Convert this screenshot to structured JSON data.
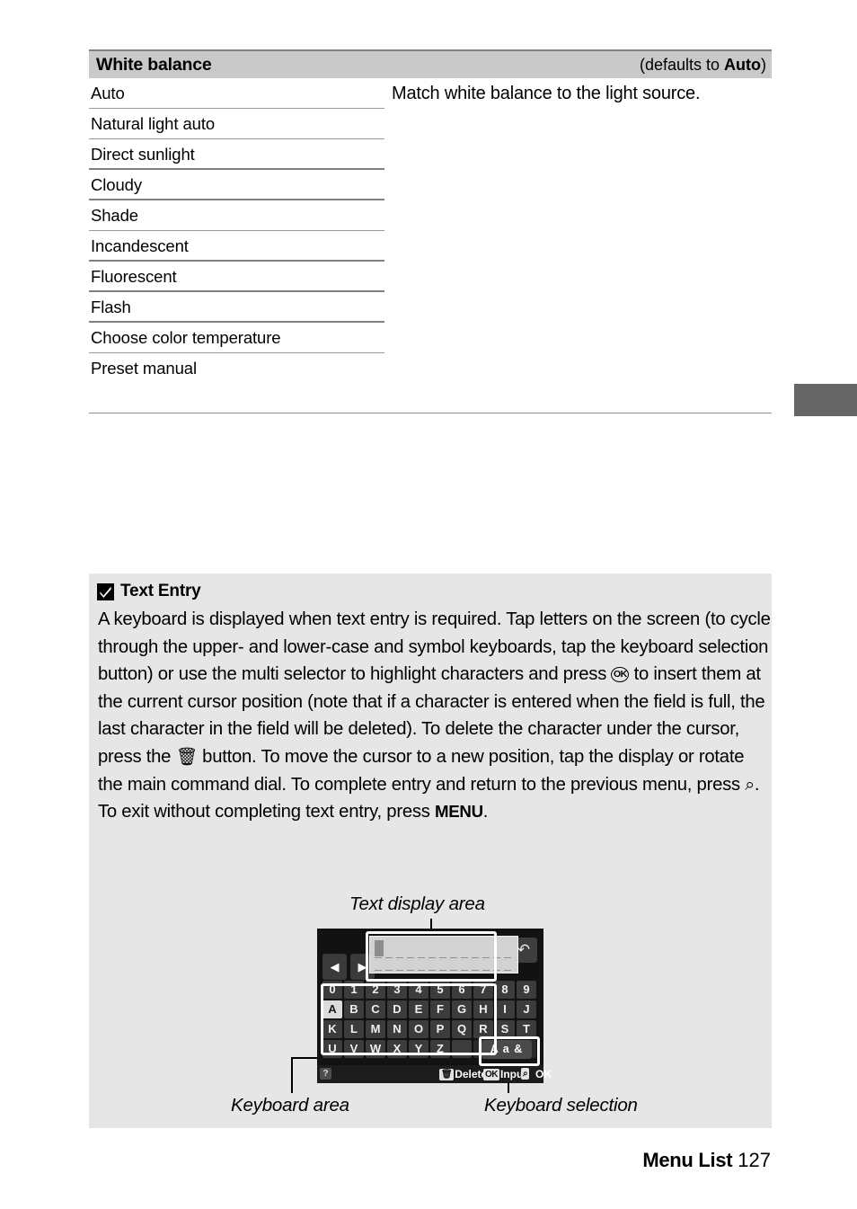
{
  "table": {
    "header": {
      "title": "White balance",
      "default_prefix": "(defaults to ",
      "default_value": "Auto",
      "default_suffix": ")"
    },
    "rows": [
      {
        "label": "Auto"
      },
      {
        "label": "Natural light auto"
      },
      {
        "label": "Direct sunlight"
      },
      {
        "label": "Cloudy"
      },
      {
        "label": "Shade"
      },
      {
        "label": "Incandescent"
      },
      {
        "label": "Fluorescent"
      },
      {
        "label": "Flash"
      },
      {
        "label": "Choose color temperature"
      },
      {
        "label": "Preset manual"
      }
    ],
    "description": "Match white balance to the light source."
  },
  "note": {
    "icon": "checkmark-box-icon",
    "title": "Text Entry",
    "body_part1": "A keyboard is displayed when text entry is required. Tap letters on the screen (to cycle through the upper- and lower-case and symbol keyboards, tap the keyboard selection button) or use the multi selector to highlight characters and press ",
    "ok_glyph": "OK",
    "body_part2": " to insert them at the current cursor position (note that if a character is entered when the field is full, the last character in the field will be deleted). To delete the character under the cursor, press the ",
    "trash_glyph": "Ὕ1",
    "body_part3": " button. To move the cursor to a new position, tap the display or rotate the main command dial. To complete entry and return to the previous menu, press ",
    "zoomin_glyph": "⌕",
    "body_part4": ". To exit without completing text entry, press ",
    "menu_word": "MENU",
    "body_part5": "."
  },
  "diagram": {
    "caption_top": "Text display area",
    "caption_left": "Keyboard area",
    "caption_right": "Keyboard selection",
    "screen": {
      "arrow_left": "◀",
      "arrow_right": "▶",
      "back_button": "↶",
      "keyboard_rows": [
        [
          "0",
          "1",
          "2",
          "3",
          "4",
          "5",
          "6",
          "7",
          "8",
          "9"
        ],
        [
          "A",
          "B",
          "C",
          "D",
          "E",
          "F",
          "G",
          "H",
          "I",
          "J"
        ],
        [
          "K",
          "L",
          "M",
          "N",
          "O",
          "P",
          "Q",
          "R",
          "S",
          "T"
        ],
        [
          "U",
          "V",
          "W",
          "X",
          "Y",
          "Z",
          "_",
          "",
          "",
          ""
        ]
      ],
      "selected_key": "A",
      "keyboard_selection_label": "A a &",
      "status": {
        "help": "?",
        "delete_label": "Delete",
        "delete_chip": "Ὕ1",
        "input_label": "Input",
        "input_chip": "OK",
        "zoom_chip": "⌕",
        "ok_label": "OK"
      }
    }
  },
  "footer": {
    "section": "Menu List",
    "page": "127"
  }
}
